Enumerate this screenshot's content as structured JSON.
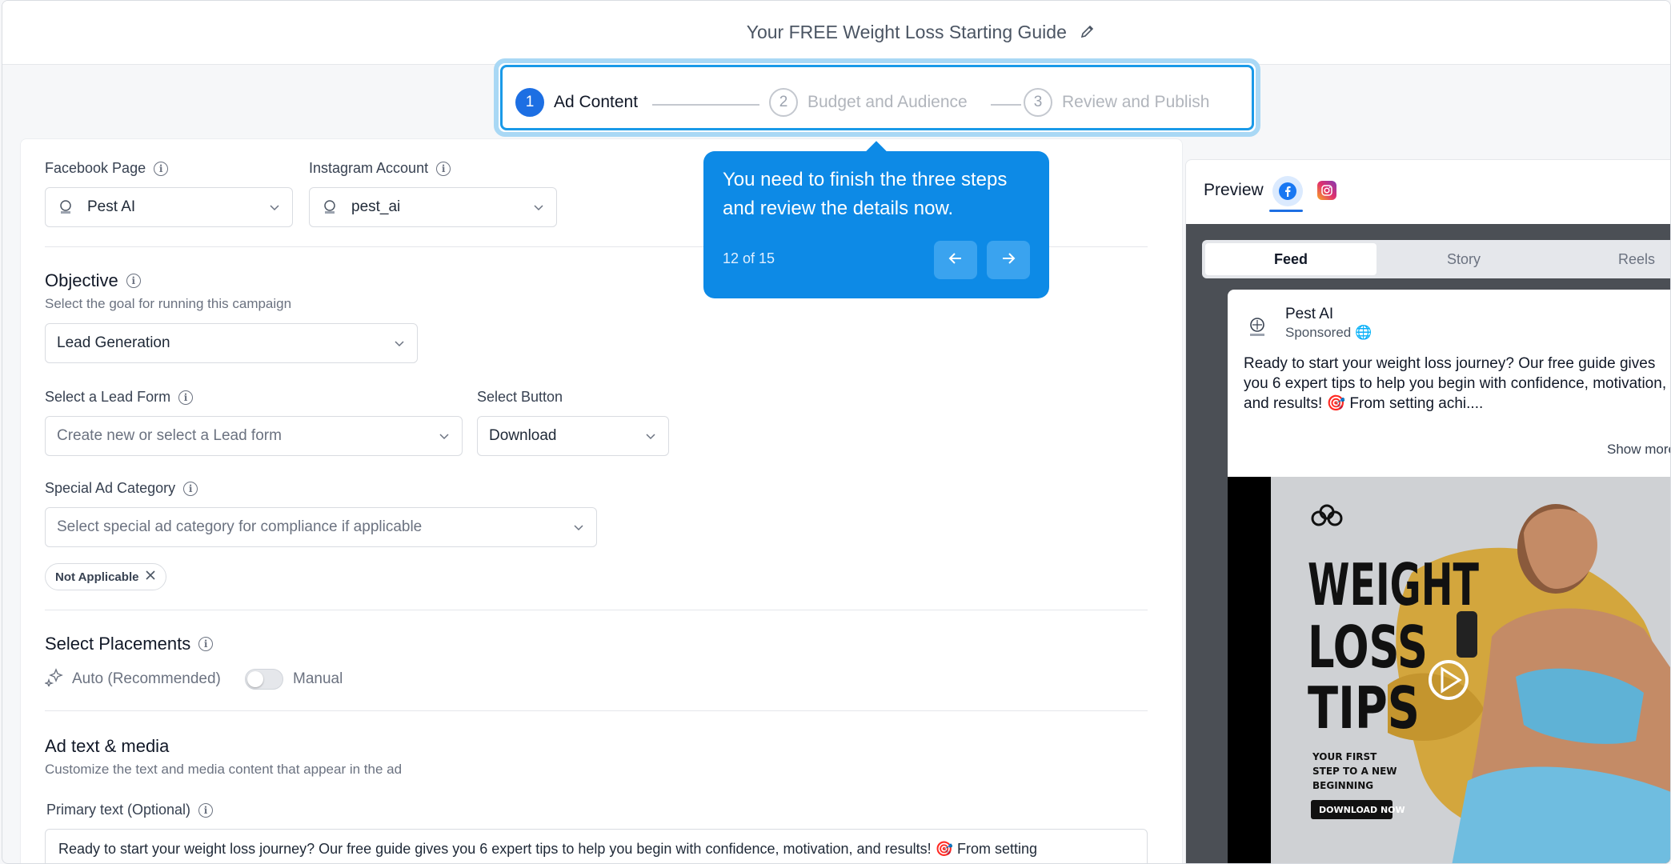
{
  "header": {
    "title": "Your FREE Weight Loss Starting Guide"
  },
  "stepper": {
    "steps": [
      {
        "num": "1",
        "label": "Ad Content"
      },
      {
        "num": "2",
        "label": "Budget and Audience"
      },
      {
        "num": "3",
        "label": "Review and Publish"
      }
    ]
  },
  "tooltip": {
    "text": "You need to finish the three steps and review the details now.",
    "counter": "12 of 15"
  },
  "form": {
    "facebook_page_label": "Facebook Page",
    "facebook_page_value": "Pest AI",
    "instagram_label": "Instagram Account",
    "instagram_value": "pest_ai",
    "objective_title": "Objective",
    "objective_sub": "Select the goal for running this campaign",
    "objective_value": "Lead Generation",
    "lead_form_label": "Select a Lead Form",
    "lead_form_placeholder": "Create new or select a Lead form",
    "button_label": "Select Button",
    "button_value": "Download",
    "special_label": "Special Ad Category",
    "special_placeholder": "Select special ad category for compliance if applicable",
    "chip_label": "Not Applicable",
    "placements_title": "Select Placements",
    "auto_label": "Auto (Recommended)",
    "manual_label": "Manual",
    "manual_on": false,
    "adtext_title": "Ad text & media",
    "adtext_sub": "Customize the text and media content that appear in the ad",
    "primary_label": "Primary text (Optional)",
    "primary_value": "Ready to start your weight loss journey? Our free guide gives you 6 expert tips to help you begin with confidence, motivation, and results! 🎯 From setting"
  },
  "preview": {
    "title": "Preview",
    "tabs": [
      "Feed",
      "Story",
      "Reels"
    ],
    "selected_tab": "Feed",
    "page_name": "Pest AI",
    "sponsored": "Sponsored",
    "post_text": "Ready to start your weight loss journey? Our free guide gives you 6 expert tips to help you begin with confidence, motivation, and results! 🎯 From setting achi....",
    "show_more": "Show more",
    "image": {
      "headline_lines": [
        "WEIGHT",
        "LOSS",
        "TIPS"
      ],
      "tagline_lines": [
        "YOUR FIRST",
        "STEP TO A NEW",
        "BEGINNING"
      ],
      "cta": "DOWNLOAD NOW"
    }
  },
  "colors": {
    "accent": "#1d6fe3",
    "tooltip": "#0d8ae6",
    "highlight": "#a9d8f5"
  }
}
